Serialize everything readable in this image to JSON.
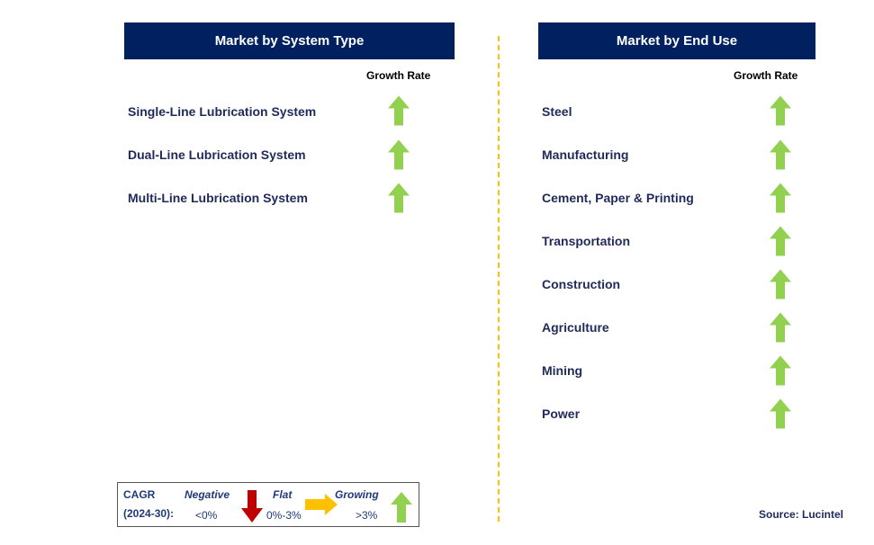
{
  "left": {
    "title": "Market by System Type",
    "growth_label": "Growth Rate",
    "items": [
      "Single-Line Lubrication System",
      "Dual-Line Lubrication System",
      "Multi-Line Lubrication System"
    ],
    "trend": "growing"
  },
  "right": {
    "title": "Market by End Use",
    "growth_label": "Growth Rate",
    "items": [
      "Steel",
      "Manufacturing",
      "Cement, Paper & Printing",
      "Transportation",
      "Construction",
      "Agriculture",
      "Mining",
      "Power"
    ],
    "trend": "growing"
  },
  "legend": {
    "cagr": "CAGR",
    "period": "(2024-30):",
    "negative": "Negative",
    "negative_range": "<0%",
    "flat": "Flat",
    "flat_range": "0%-3%",
    "growing": "Growing",
    "growing_range": ">3%"
  },
  "source": "Source: Lucintel",
  "colors": {
    "header": "#002060",
    "growing": "#92D050",
    "flat": "#FFC000",
    "negative": "#C00000",
    "divider": "#FFC000"
  }
}
